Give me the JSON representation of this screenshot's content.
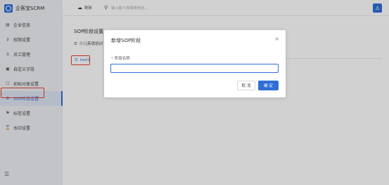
{
  "brand": {
    "name": "企客宝SCRM"
  },
  "sidebar": {
    "items": [
      {
        "label": "企业信息",
        "icon": "building-icon"
      },
      {
        "label": "权限设置",
        "icon": "key-icon"
      },
      {
        "label": "员工管理",
        "icon": "user-icon"
      },
      {
        "label": "自定义字段",
        "icon": "form-icon"
      },
      {
        "label": "初始分类设置",
        "icon": "square-icon"
      },
      {
        "label": "SOP阶段设置",
        "icon": "sop-icon",
        "active": true
      },
      {
        "label": "标签设置",
        "icon": "tag-icon"
      },
      {
        "label": "水印设置",
        "icon": "watermark-icon"
      }
    ]
  },
  "topbar": {
    "refresh_label": "刷新",
    "search_placeholder": "输入客户/所联络电话..."
  },
  "main": {
    "title": "SOP阶段设置",
    "tree_root": "少儿英语培训",
    "tree_child": "test1"
  },
  "modal": {
    "title": "新增SOP阶段",
    "field_label": "阶段名称",
    "field_value": "",
    "cancel_label": "取 消",
    "ok_label": "确 定"
  },
  "colors": {
    "accent": "#2f6fd6",
    "highlight": "#e4442e"
  }
}
